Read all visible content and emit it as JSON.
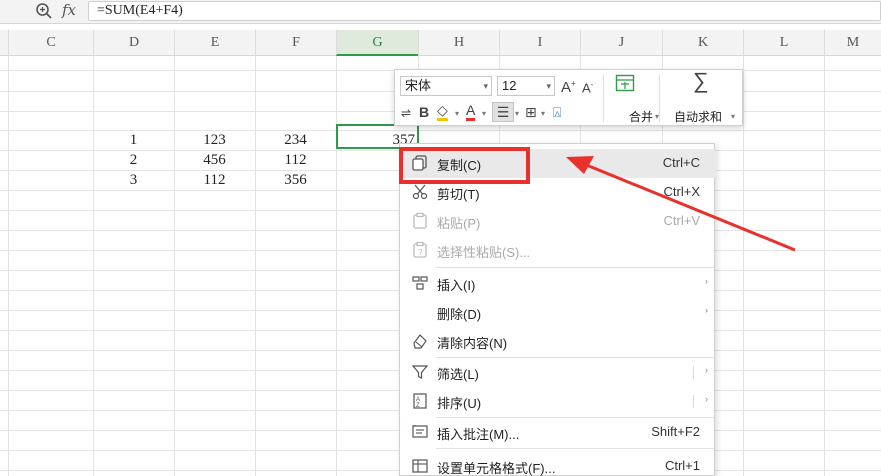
{
  "formula_bar": {
    "formula": "=SUM(E4+F4)",
    "fx_label": "fx"
  },
  "columns": [
    "C",
    "D",
    "E",
    "F",
    "G",
    "H",
    "I",
    "J",
    "K",
    "L",
    "M"
  ],
  "rows": [
    {
      "d": "1",
      "e": "123",
      "f": "234",
      "g": "357"
    },
    {
      "d": "2",
      "e": "456",
      "f": "112",
      "g": ""
    },
    {
      "d": "3",
      "e": "112",
      "f": "356",
      "g": ""
    }
  ],
  "mini_toolbar": {
    "font_name": "宋体",
    "font_size": "12",
    "grow_font": "A",
    "shrink_font": "A",
    "bold": "B",
    "font_color": "A",
    "merge_label": "合并",
    "autosum_symbol": "∑",
    "autosum_label": "自动求和"
  },
  "context_menu": {
    "items": [
      {
        "label": "复制(C)",
        "shortcut": "Ctrl+C",
        "icon": "copy-icon"
      },
      {
        "label": "剪切(T)",
        "shortcut": "Ctrl+X",
        "icon": "scissors-icon"
      },
      {
        "label": "粘贴(P)",
        "shortcut": "Ctrl+V",
        "icon": "paste-icon"
      },
      {
        "label": "选择性粘贴(S)...",
        "shortcut": "",
        "icon": "paste-special-icon"
      },
      {
        "label": "插入(I)",
        "shortcut": "",
        "icon": "insert-icon"
      },
      {
        "label": "删除(D)",
        "shortcut": "",
        "icon": ""
      },
      {
        "label": "清除内容(N)",
        "shortcut": "",
        "icon": "eraser-icon"
      },
      {
        "label": "筛选(L)",
        "shortcut": "",
        "icon": "filter-icon"
      },
      {
        "label": "排序(U)",
        "shortcut": "",
        "icon": "sort-icon"
      },
      {
        "label": "插入批注(M)...",
        "shortcut": "Shift+F2",
        "icon": "comment-icon"
      },
      {
        "label": "设置单元格格式(F)...",
        "shortcut": "Ctrl+1",
        "icon": "format-cells-icon"
      }
    ]
  },
  "colors": {
    "accent_green": "#2e9a4a",
    "annotation_red": "#e8302c"
  }
}
